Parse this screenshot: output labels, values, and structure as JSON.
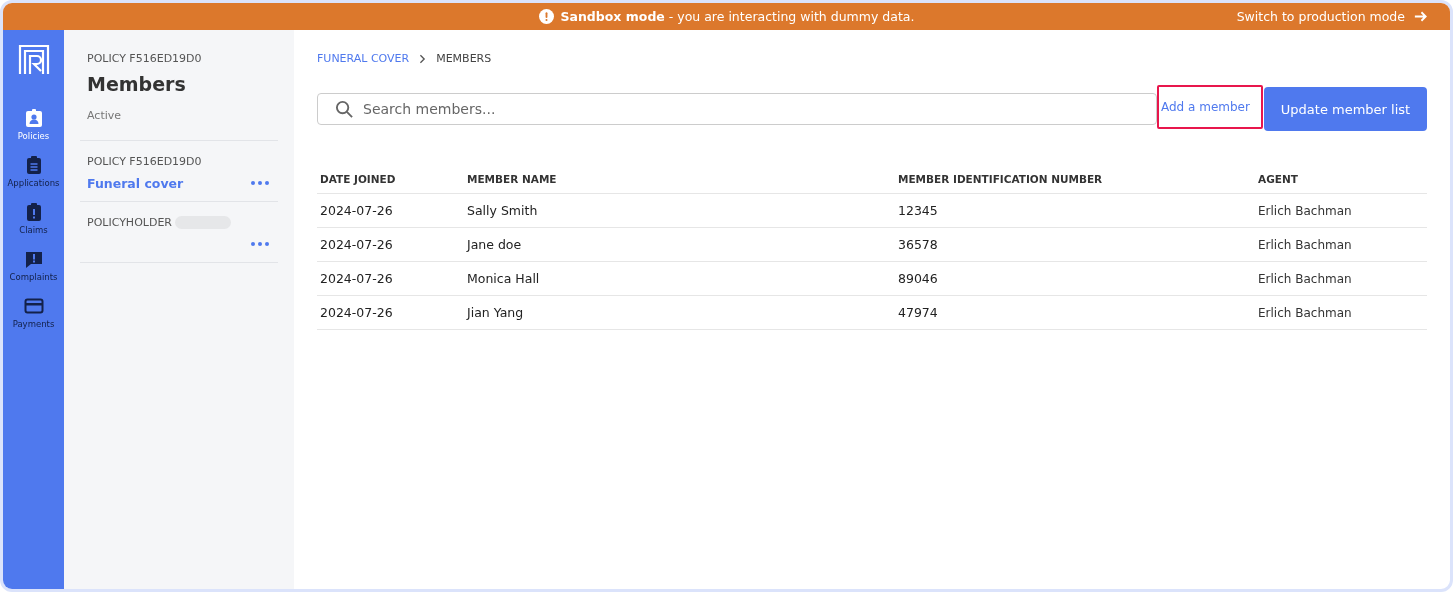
{
  "banner": {
    "message": "**Sandbox mode** - you are interacting with dummy data.",
    "action": "Switch to production mode"
  },
  "nav": [
    {
      "label": "Policies",
      "kind": "badge",
      "selected": true
    },
    {
      "label": "Applications",
      "kind": "clipboard",
      "selected": false
    },
    {
      "label": "Claims",
      "kind": "alert",
      "selected": false
    },
    {
      "label": "Complaints",
      "kind": "bubble",
      "selected": false
    },
    {
      "label": "Payments",
      "kind": "card",
      "selected": false
    }
  ],
  "panel": {
    "eyebrow": "POLICY F516ED19D0",
    "title": "Members",
    "status": "Active",
    "sections": [
      {
        "label": "POLICY F516ED19D0",
        "link": "Funeral cover",
        "redacted": false
      },
      {
        "label": "POLICYHOLDER",
        "redacted": true
      }
    ]
  },
  "breadcrumb": [
    {
      "label": "FUNERAL COVER",
      "link": true
    },
    {
      "label": "MEMBERS",
      "link": false
    }
  ],
  "search": {
    "placeholder": "Search members..."
  },
  "buttons": {
    "add": "Add a member",
    "update": "Update member list"
  },
  "table": {
    "columns": [
      "DATE JOINED",
      "MEMBER NAME",
      "MEMBER IDENTIFICATION NUMBER",
      "AGENT"
    ],
    "rows": [
      [
        "2024-07-26",
        "Sally Smith",
        "12345",
        "Erlich Bachman"
      ],
      [
        "2024-07-26",
        "Jane doe",
        "36578",
        "Erlich Bachman"
      ],
      [
        "2024-07-26",
        "Monica Hall",
        "89046",
        "Erlich Bachman"
      ],
      [
        "2024-07-26",
        "Jian Yang",
        "47974",
        "Erlich Bachman"
      ]
    ]
  }
}
